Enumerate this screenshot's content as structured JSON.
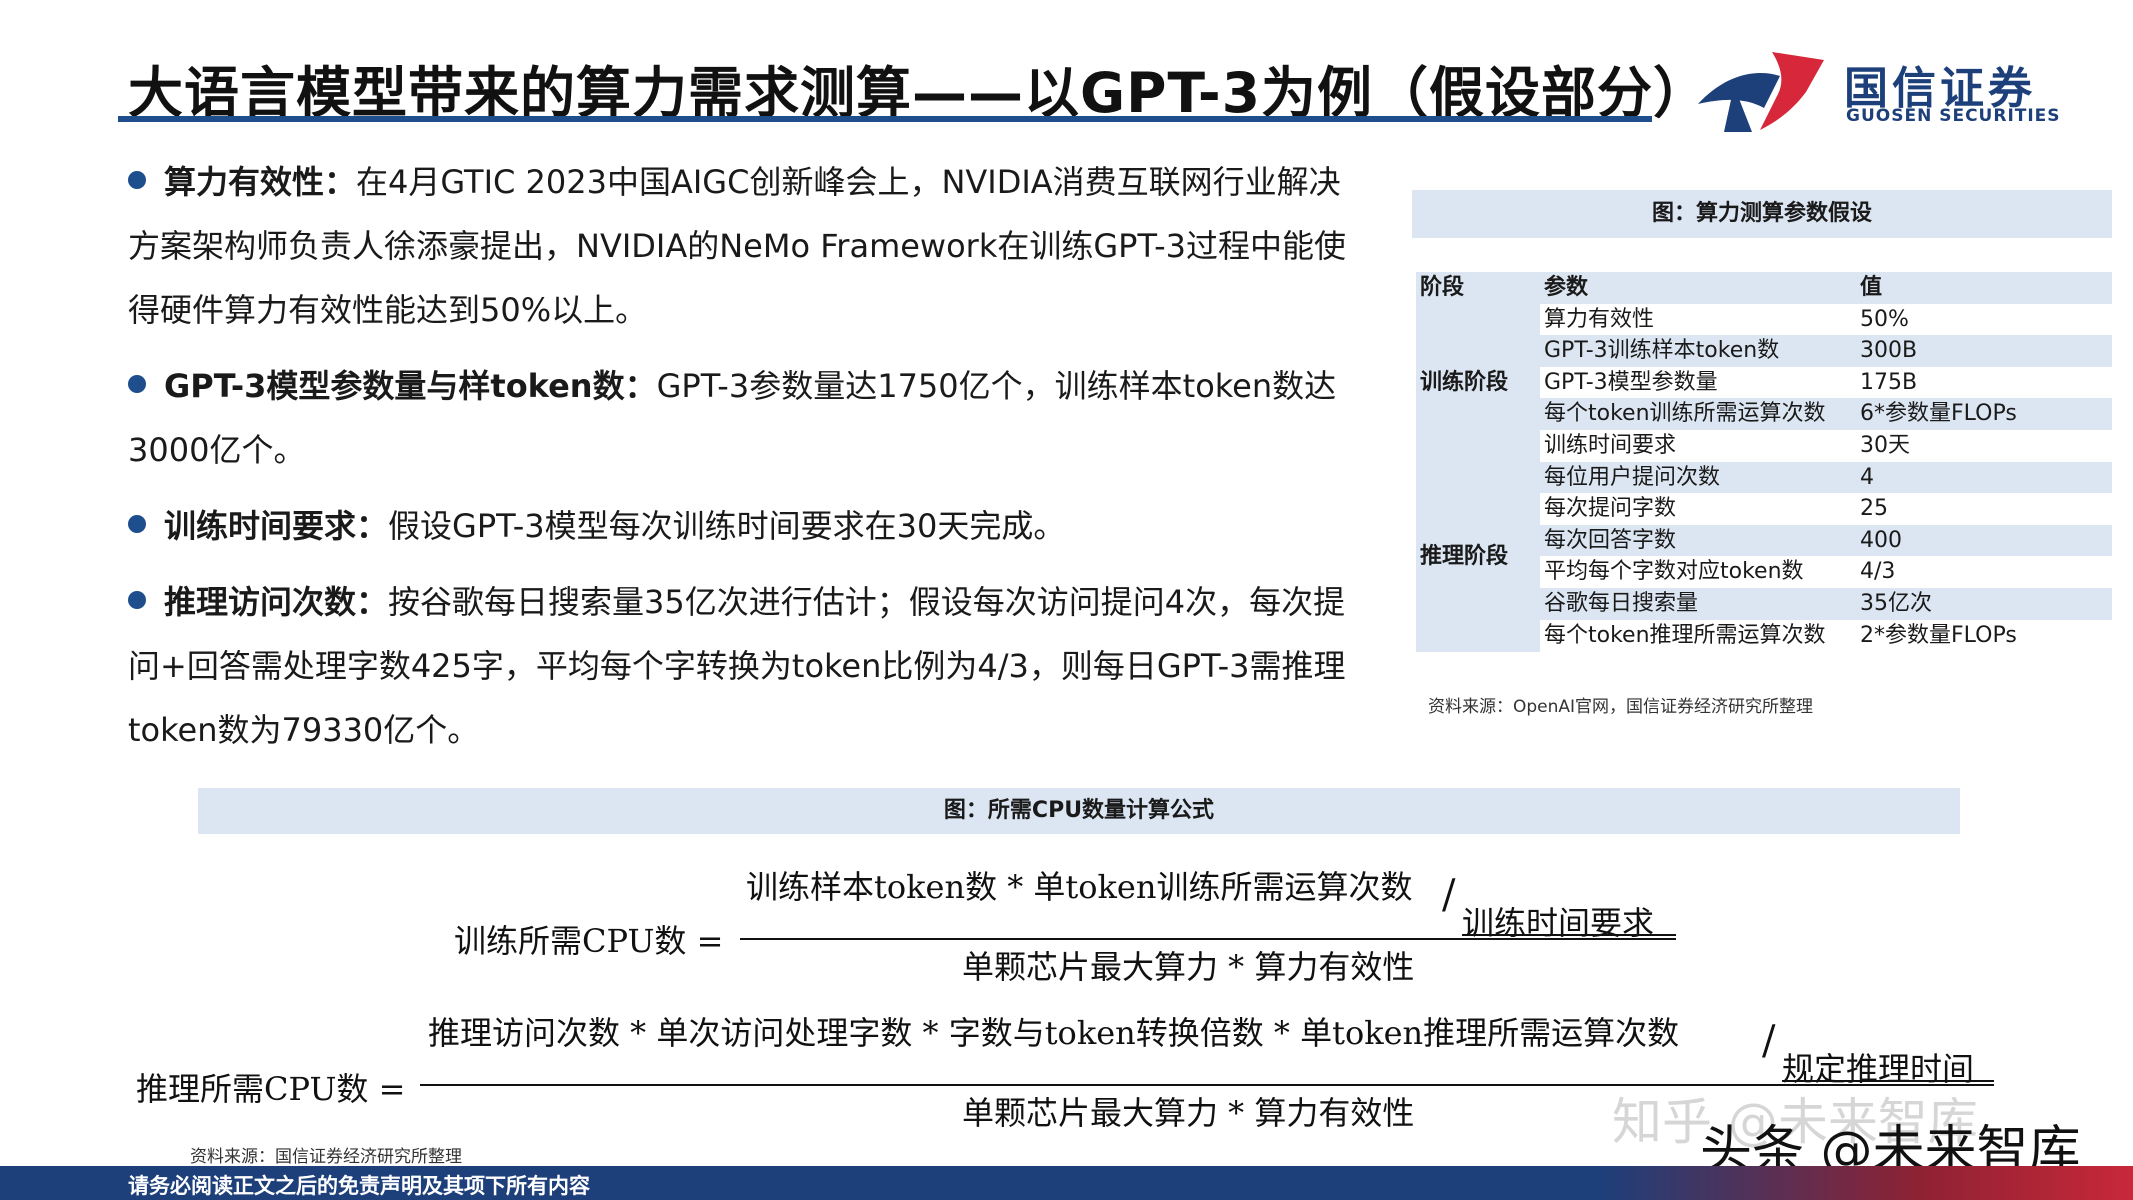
{
  "header": {
    "title": "大语言模型带来的算力需求测算——以GPT-3为例（假设部分）",
    "logo_cn": "国信证券",
    "logo_en": "GUOSEN SECURITIES"
  },
  "bullets": [
    {
      "head": "算力有效性：",
      "body": "在4月GTIC 2023中国AIGC创新峰会上，NVIDIA消费互联网行业解决方案架构师负责人徐添豪提出，NVIDIA的NeMo Framework在训练GPT-3过程中能使得硬件算力有效性能达到50%以上。"
    },
    {
      "head": "GPT-3模型参数量与样token数：",
      "body": "GPT-3参数量达1750亿个，训练样本token数达3000亿个。"
    },
    {
      "head": "训练时间要求：",
      "body": "假设GPT-3模型每次训练时间要求在30天完成。"
    },
    {
      "head": "推理访问次数：",
      "body": "按谷歌每日搜索量35亿次进行估计；假设每次访问提问4次，每次提问+回答需处理字数425字，平均每个字转换为token比例为4/3，则每日GPT-3需推理token数为79330亿个。"
    }
  ],
  "param_table": {
    "title": "图：算力测算参数假设",
    "headers": [
      "阶段",
      "参数",
      "值"
    ],
    "stages": [
      "训练阶段",
      "推理阶段"
    ],
    "rows": [
      {
        "param": "算力有效性",
        "value": "50%"
      },
      {
        "param": "GPT-3训练样本token数",
        "value": "300B"
      },
      {
        "param": "GPT-3模型参数量",
        "value": "175B"
      },
      {
        "param": "每个token训练所需运算次数",
        "value": "6*参数量FLOPs"
      },
      {
        "param": "训练时间要求",
        "value": "30天"
      },
      {
        "param": "每位用户提问次数",
        "value": "4"
      },
      {
        "param": "每次提问字数",
        "value": "25"
      },
      {
        "param": "每次回答字数",
        "value": "400"
      },
      {
        "param": "平均每个字数对应token数",
        "value": "4/3"
      },
      {
        "param": "谷歌每日搜索量",
        "value": "35亿次"
      },
      {
        "param": "每个token推理所需运算次数",
        "value": "2*参数量FLOPs"
      }
    ],
    "source": "资料来源：OpenAI官网，国信证券经济研究所整理"
  },
  "formula": {
    "title": "图：所需CPU数量计算公式",
    "train_lhs": "训练所需CPU数 =",
    "train_num": "训练样本token数 * 单token训练所需运算次数",
    "train_time": "训练时间要求",
    "train_den": "单颗芯片最大算力 * 算力有效性",
    "infer_lhs": "推理所需CPU数 =",
    "infer_num": "推理访问次数 * 单次访问处理字数 * 字数与token转换倍数 * 单token推理所需运算次数",
    "infer_time": "规定推理时间",
    "infer_den": "单颗芯片最大算力 * 算力有效性",
    "source": "资料来源：国信证券经济研究所整理"
  },
  "footer": {
    "disclaimer": "请务必阅读正文之后的免责声明及其项下所有内容"
  },
  "watermark": {
    "zhihu": "知乎 @未来智库",
    "toutiao": "头条 @未来智库"
  }
}
